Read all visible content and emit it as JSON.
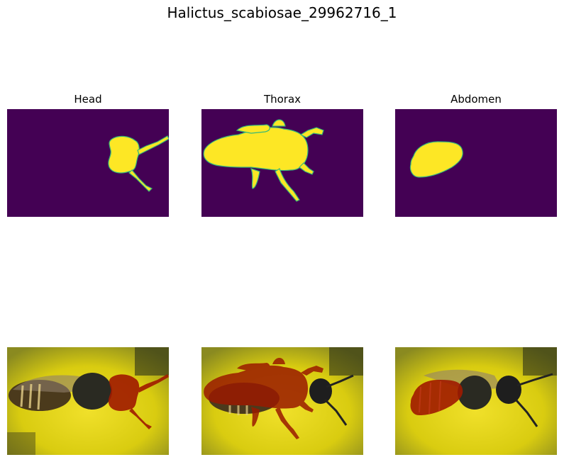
{
  "figure": {
    "title": "Halictus_scabiosae_29962716_1"
  },
  "panels": [
    {
      "title": "Head"
    },
    {
      "title": "Thorax"
    },
    {
      "title": "Abdomen"
    }
  ],
  "colors": {
    "mask_background": "#440154",
    "mask_foreground": "#fde725",
    "mask_edge": "#35b779",
    "overlay": "#a01a00",
    "flower": "#d9cc10"
  }
}
